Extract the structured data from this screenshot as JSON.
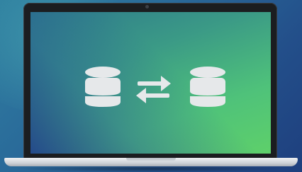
{
  "scene": {
    "subject": "laptop",
    "icons": [
      "database-icon",
      "transfer-arrows-icon",
      "database-icon"
    ]
  },
  "colors": {
    "background": "#2a6b9a",
    "screen_green": "#5ed06a",
    "screen_blue": "#1e3f7e",
    "icon_fill": "#e6e8ea",
    "laptop_bezel": "#1b1d20",
    "laptop_base": "#cfd3d8"
  }
}
